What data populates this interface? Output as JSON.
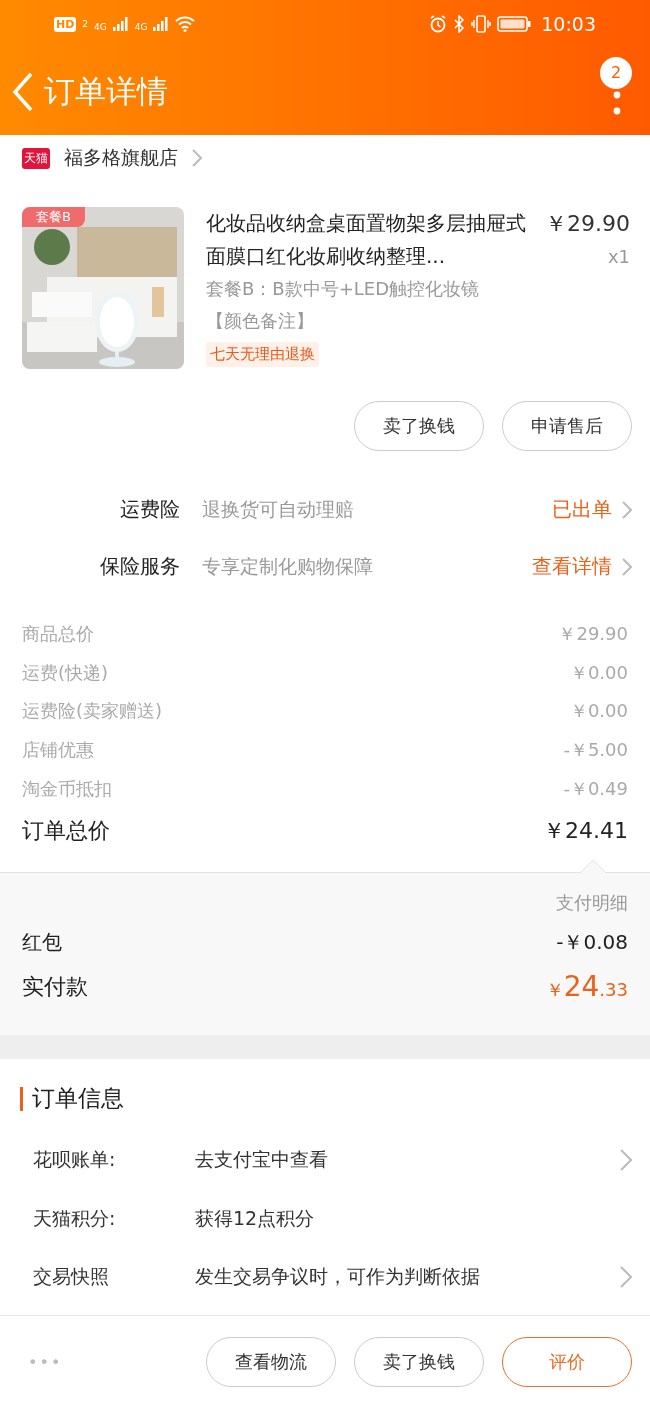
{
  "status_bar": {
    "time": "10:03",
    "hd": "HD",
    "sim": "2",
    "net1": "4G",
    "net2": "4G"
  },
  "header": {
    "title": "订单详情",
    "badge": "2"
  },
  "shop": {
    "logo": "天猫",
    "name": "福多格旗舰店"
  },
  "product": {
    "image": {
      "kind": "picture",
      "badge": "套餐B"
    },
    "title": "化妆品收纳盒桌面置物架多层抽屉式面膜口红化妆刷收纳整理...",
    "price": "￥29.90",
    "quantity": "x1",
    "spec": "套餐B：B款中号+LED触控化妆镜",
    "note": "【颜色备注】",
    "tag": "七天无理由退换"
  },
  "product_buttons": [
    "卖了换钱",
    "申请售后"
  ],
  "services": [
    {
      "label": "运费险",
      "desc": "退换货可自动理赔",
      "action": "已出单"
    },
    {
      "label": "保险服务",
      "desc": "专享定制化购物保障",
      "action": "查看详情"
    }
  ],
  "costs": [
    {
      "label": "商品总价",
      "value": "￥29.90"
    },
    {
      "label": "运费(快递)",
      "value": "￥0.00"
    },
    {
      "label": "运费险(卖家赠送)",
      "value": "￥0.00"
    },
    {
      "label": "店铺优惠",
      "value": "-￥5.00"
    },
    {
      "label": "淘金币抵扣",
      "value": "-￥0.49"
    }
  ],
  "total": {
    "label": "订单总价",
    "value": "￥24.41"
  },
  "payment": {
    "detail": "支付明细",
    "red_packet": {
      "label": "红包",
      "value": "-￥0.08"
    },
    "paid": {
      "label": "实付款",
      "symbol": "￥",
      "integer": "24",
      "decimal": ".33"
    }
  },
  "order_info": {
    "title": "订单信息",
    "rows": [
      {
        "label": "花呗账单:",
        "value": "去支付宝中查看",
        "arrow": true
      },
      {
        "label": "天猫积分:",
        "value": "获得12点积分",
        "arrow": false
      },
      {
        "label": "交易快照",
        "value": "发生交易争议时，可作为判断依据",
        "arrow": true
      }
    ]
  },
  "bottom_bar": {
    "more": "•••",
    "buttons": [
      {
        "label": "查看物流",
        "primary": false
      },
      {
        "label": "卖了换钱",
        "primary": false
      },
      {
        "label": "评价",
        "primary": true
      }
    ]
  }
}
